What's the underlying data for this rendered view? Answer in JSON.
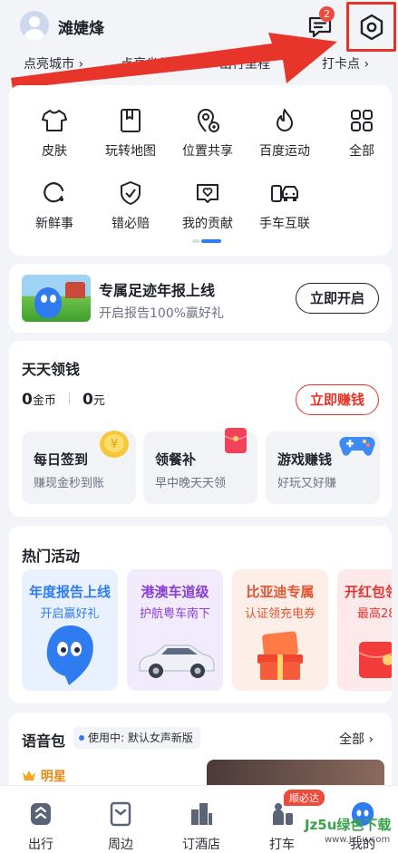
{
  "header": {
    "username": "滩婕烽",
    "message_badge": "2"
  },
  "stats": [
    {
      "label": "点亮城市"
    },
    {
      "label": "点亮省份"
    },
    {
      "label": "出行里程"
    },
    {
      "label": "打卡点"
    }
  ],
  "features": [
    {
      "label": "皮肤",
      "icon": "tshirt-icon"
    },
    {
      "label": "玩转地图",
      "icon": "bookmark-map-icon"
    },
    {
      "label": "位置共享",
      "icon": "location-share-icon"
    },
    {
      "label": "百度运动",
      "icon": "flame-icon"
    },
    {
      "label": "全部",
      "icon": "grid-all-icon"
    },
    {
      "label": "新鲜事",
      "icon": "fresh-news-icon"
    },
    {
      "label": "错必赔",
      "icon": "shield-check-icon"
    },
    {
      "label": "我的贡献",
      "icon": "contribution-heart-icon"
    },
    {
      "label": "手车互联",
      "icon": "phone-car-icon"
    }
  ],
  "annual_report": {
    "title": "专属足迹年报上线",
    "subtitle": "开启报告100%赢好礼",
    "button": "立即开启"
  },
  "earn": {
    "title": "天天领钱",
    "coins_value": "0",
    "coins_unit": "金币",
    "cash_value": "0",
    "cash_unit": "元",
    "button": "立即赚钱",
    "tasks": [
      {
        "title": "每日签到",
        "subtitle": "赚现金秒到账"
      },
      {
        "title": "领餐补",
        "subtitle": "早中晚天天领"
      },
      {
        "title": "游戏赚钱",
        "subtitle": "好玩又好赚"
      }
    ]
  },
  "hot": {
    "title": "热门活动",
    "cards": [
      {
        "title": "年度报告上线",
        "subtitle": "开启赢好礼",
        "title_color": "#2f7cf0",
        "sub_color": "#2f7cf0",
        "bg": "#e8f1fd"
      },
      {
        "title": "港澳车道级",
        "subtitle": "护航粤车南下",
        "title_color": "#8a3fd6",
        "sub_color": "#8a3fd6",
        "bg": "#f1ebfb"
      },
      {
        "title": "比亚迪专属",
        "subtitle": "认证领充电券",
        "title_color": "#e0542f",
        "sub_color": "#e0542f",
        "bg": "#fdeee8"
      },
      {
        "title": "开红包领",
        "subtitle": "最高28",
        "title_color": "#e0362f",
        "sub_color": "#e0362f",
        "bg": "#fde9e9"
      }
    ]
  },
  "voice": {
    "title": "语音包",
    "status": "使用中: 默认女声新版",
    "all_label": "全部",
    "star_label": "明星"
  },
  "bottom_nav": [
    {
      "label": "出行"
    },
    {
      "label": "周边"
    },
    {
      "label": "订酒店"
    },
    {
      "label": "打车"
    },
    {
      "label": "我的"
    }
  ],
  "nav_badge": "顺必达",
  "watermark": {
    "line1": "Jz5u绿色下载",
    "line2": "www.Jz5u.com"
  },
  "colors": {
    "accent": "#2f7cf0",
    "danger": "#e53325",
    "badge": "#f04a3c"
  }
}
